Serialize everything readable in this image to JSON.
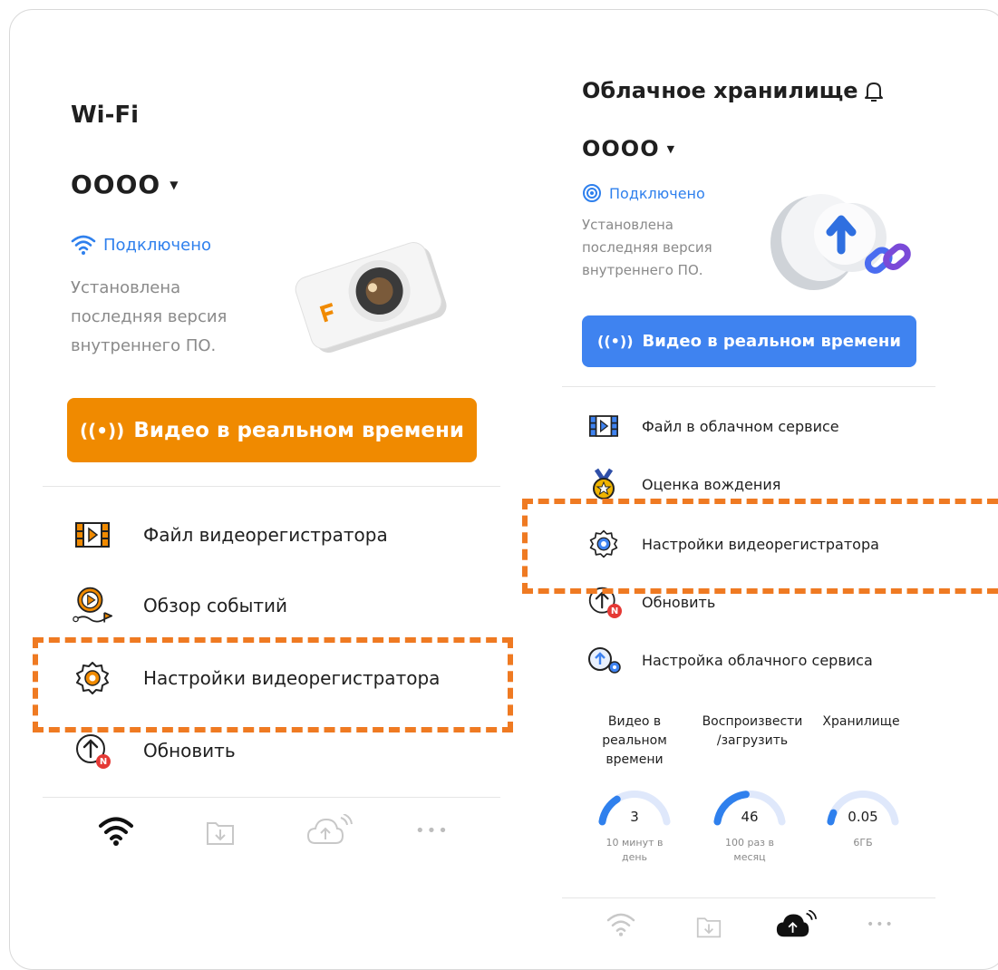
{
  "colors": {
    "accent_orange": "#f08a00",
    "accent_blue": "#2f80ed",
    "highlight_dash": "#ef7a22",
    "badge_red": "#e53935"
  },
  "left": {
    "title": "Wi-Fi",
    "device_name": "OOOO",
    "status": "Подключено",
    "firmware_line1": "Установлена",
    "firmware_line2": "последняя версия",
    "firmware_line3": "внутреннего ПО.",
    "live_button": "Видео в реальном времени",
    "menu": [
      {
        "label": "Файл видеорегистратора",
        "icon": "film-file-icon"
      },
      {
        "label": "Обзор событий",
        "icon": "event-play-icon"
      },
      {
        "label": "Настройки видеорегистратора",
        "icon": "gear-icon"
      },
      {
        "label": "Обновить",
        "icon": "update-arrow-icon",
        "badge": "N"
      }
    ],
    "bottom_nav": [
      "wifi-icon",
      "download-folder-icon",
      "cloud-upload-icon",
      "more-icon"
    ]
  },
  "right": {
    "title": "Облачное хранилище",
    "device_name": "OOOO",
    "status": "Подключено",
    "firmware_line1": "Установлена",
    "firmware_line2": "последняя версия",
    "firmware_line3": "внутреннего ПО.",
    "live_button": "Видео в реальном времени",
    "menu": [
      {
        "label": "Файл в облачном сервисе",
        "icon": "film-file-icon"
      },
      {
        "label": "Оценка вождения",
        "icon": "medal-icon"
      },
      {
        "label": "Настройки видеорегистратора",
        "icon": "gear-icon"
      },
      {
        "label": "Обновить",
        "icon": "update-arrow-icon",
        "badge": "N"
      },
      {
        "label": "Настройка облачного сервиса",
        "icon": "cloud-settings-icon"
      }
    ],
    "stats": [
      {
        "head1": "Видео в",
        "head2": "реальном",
        "head3": "времени",
        "value": "3",
        "sub1": "10 минут в",
        "sub2": "день",
        "fraction": 0.3
      },
      {
        "head1": "Воспроизвести",
        "head2": "/загрузить",
        "head3": "",
        "value": "46",
        "sub1": "100 раз в",
        "sub2": "месяц",
        "fraction": 0.46
      },
      {
        "head1": "Хранилище",
        "head2": "",
        "head3": "",
        "value": "0.05",
        "sub1": "6ГБ",
        "sub2": "",
        "fraction": 0.1
      }
    ],
    "bottom_nav": [
      "wifi-icon",
      "download-folder-icon",
      "cloud-upload-icon",
      "more-icon"
    ]
  }
}
